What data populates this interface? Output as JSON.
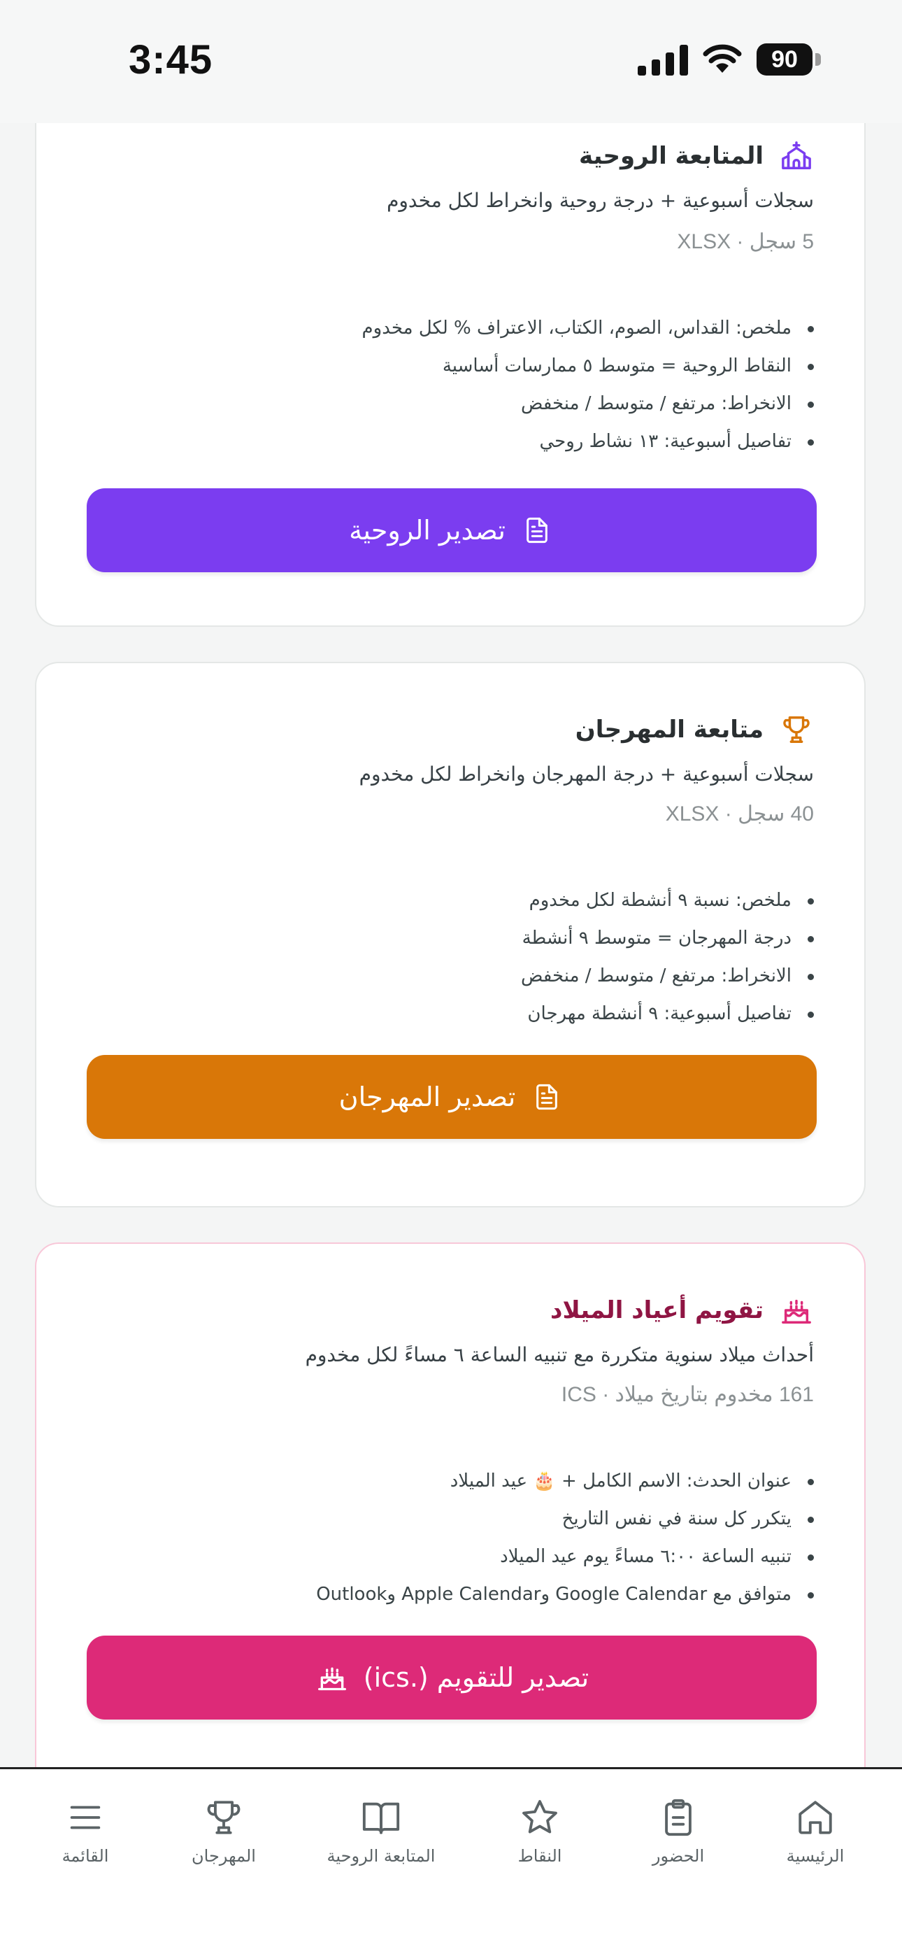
{
  "status_bar": {
    "time": "3:45",
    "battery": "90"
  },
  "cards": {
    "spiritual": {
      "title": "المتابعة الروحية",
      "description": "سجلات أسبوعية + درجة روحية وانخراط لكل مخدوم",
      "meta": "5 سجل · XLSX",
      "bullets": [
        "ملخص: القداس، الصوم، الكتاب، الاعتراف % لكل مخدوم",
        "النقاط الروحية = متوسط ٥ ممارسات أساسية",
        "الانخراط: مرتفع / متوسط / منخفض",
        "تفاصيل أسبوعية: ١٣ نشاط روحي"
      ],
      "button_label": "تصدير الروحية",
      "accent": "#7b3df0",
      "title_color": "#2a2f31",
      "icon": "church-icon"
    },
    "festival": {
      "title": "متابعة المهرجان",
      "description": "سجلات أسبوعية + درجة المهرجان وانخراط لكل مخدوم",
      "meta": "40 سجل · XLSX",
      "bullets": [
        "ملخص: نسبة ٩ أنشطة لكل مخدوم",
        "درجة المهرجان = متوسط ٩ أنشطة",
        "الانخراط: مرتفع / متوسط / منخفض",
        "تفاصيل أسبوعية: ٩ أنشطة مهرجان"
      ],
      "button_label": "تصدير المهرجان",
      "accent": "#d97708",
      "title_color": "#2a2f31",
      "icon": "trophy-icon"
    },
    "birthdays": {
      "title": "تقويم أعياد الميلاد",
      "description": "أحداث ميلاد سنوية متكررة مع تنبيه الساعة ٦ مساءً لكل مخدوم",
      "meta": "161 مخدوم بتاريخ ميلاد · ICS",
      "bullets": [
        "عنوان الحدث: الاسم الكامل + 🎂 عيد الميلاد",
        "يتكرر كل سنة في نفس التاريخ",
        "تنبيه الساعة ٦:٠٠ مساءً يوم عيد الميلاد",
        "متوافق مع Google Calendar وApple Calendar وOutlook"
      ],
      "button_label": "تصدير للتقويم (.ics)",
      "accent": "#dd2a78",
      "title_color": "#8f1543",
      "icon": "cake-icon"
    }
  },
  "tab_bar": {
    "items": [
      {
        "label": "الرئيسية",
        "icon": "home-icon"
      },
      {
        "label": "الحضور",
        "icon": "clipboard-icon"
      },
      {
        "label": "النقاط",
        "icon": "star-icon"
      },
      {
        "label": "المتابعة الروحية",
        "icon": "book-icon"
      },
      {
        "label": "المهرجان",
        "icon": "trophy-icon"
      },
      {
        "label": "القائمة",
        "icon": "menu-icon"
      }
    ]
  }
}
